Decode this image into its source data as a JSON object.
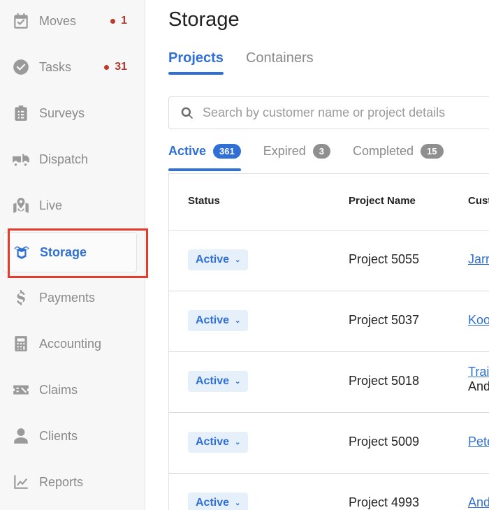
{
  "sidebar": {
    "items": [
      {
        "label": "Moves",
        "icon": "calendar-check-icon",
        "badge": "1"
      },
      {
        "label": "Tasks",
        "icon": "check-circle-icon",
        "badge": "31"
      },
      {
        "label": "Surveys",
        "icon": "clipboard-icon"
      },
      {
        "label": "Dispatch",
        "icon": "truck-icon"
      },
      {
        "label": "Live",
        "icon": "map-icon"
      },
      {
        "label": "Storage",
        "icon": "box-icon",
        "active": true
      },
      {
        "label": "Payments",
        "icon": "dollar-icon"
      },
      {
        "label": "Accounting",
        "icon": "calculator-icon"
      },
      {
        "label": "Claims",
        "icon": "claim-ticket-icon"
      },
      {
        "label": "Clients",
        "icon": "user-icon"
      },
      {
        "label": "Reports",
        "icon": "chart-icon"
      }
    ]
  },
  "page": {
    "title": "Storage"
  },
  "tabs": [
    {
      "label": "Projects",
      "active": true
    },
    {
      "label": "Containers"
    }
  ],
  "search": {
    "placeholder": "Search by customer name or project details"
  },
  "subtabs": [
    {
      "label": "Active",
      "count": "361",
      "active": true
    },
    {
      "label": "Expired",
      "count": "3"
    },
    {
      "label": "Completed",
      "count": "15"
    }
  ],
  "table": {
    "headers": [
      "Status",
      "Project Name",
      "Cust"
    ],
    "rows": [
      {
        "status": "Active",
        "project": "Project 5055",
        "customer": "Jarr",
        "customer_sub": ""
      },
      {
        "status": "Active",
        "project": "Project 5037",
        "customer": "Koo",
        "customer_sub": ""
      },
      {
        "status": "Active",
        "project": "Project 5018",
        "customer": "Trai",
        "customer_sub": "And"
      },
      {
        "status": "Active",
        "project": "Project 5009",
        "customer": "Pete",
        "customer_sub": ""
      },
      {
        "status": "Active",
        "project": "Project 4993",
        "customer": "And",
        "customer_sub": ""
      }
    ]
  },
  "colors": {
    "accent": "#2f6fd6",
    "badge": "#c0392b",
    "highlight": "#e53b2c"
  }
}
